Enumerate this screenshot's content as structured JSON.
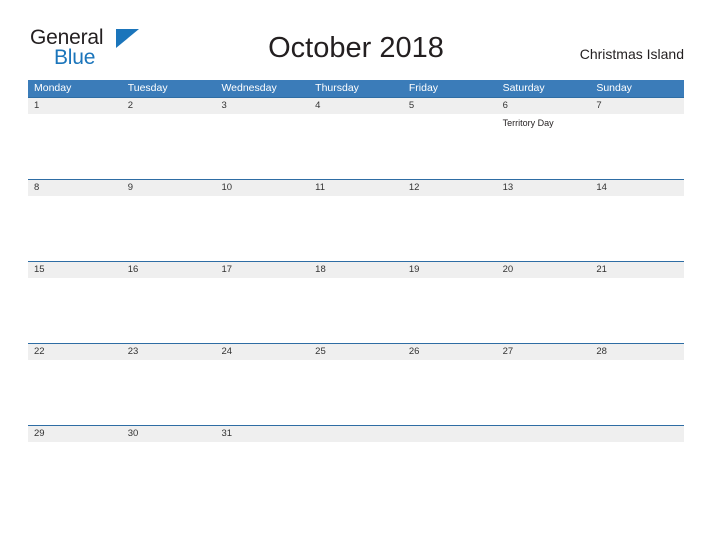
{
  "brand": {
    "name_top": "General",
    "name_bottom": "Blue",
    "triangle_icon": "triangle-icon",
    "accent_color": "#1b75bb"
  },
  "header": {
    "title": "October 2018",
    "location": "Christmas Island"
  },
  "calendar": {
    "header_color": "#3b7cb9",
    "band_color": "#efefef",
    "weekdays": [
      "Monday",
      "Tuesday",
      "Wednesday",
      "Thursday",
      "Friday",
      "Saturday",
      "Sunday"
    ],
    "weeks": [
      {
        "days": [
          {
            "num": "1",
            "event": ""
          },
          {
            "num": "2",
            "event": ""
          },
          {
            "num": "3",
            "event": ""
          },
          {
            "num": "4",
            "event": ""
          },
          {
            "num": "5",
            "event": ""
          },
          {
            "num": "6",
            "event": "Territory Day"
          },
          {
            "num": "7",
            "event": ""
          }
        ]
      },
      {
        "days": [
          {
            "num": "8",
            "event": ""
          },
          {
            "num": "9",
            "event": ""
          },
          {
            "num": "10",
            "event": ""
          },
          {
            "num": "11",
            "event": ""
          },
          {
            "num": "12",
            "event": ""
          },
          {
            "num": "13",
            "event": ""
          },
          {
            "num": "14",
            "event": ""
          }
        ]
      },
      {
        "days": [
          {
            "num": "15",
            "event": ""
          },
          {
            "num": "16",
            "event": ""
          },
          {
            "num": "17",
            "event": ""
          },
          {
            "num": "18",
            "event": ""
          },
          {
            "num": "19",
            "event": ""
          },
          {
            "num": "20",
            "event": ""
          },
          {
            "num": "21",
            "event": ""
          }
        ]
      },
      {
        "days": [
          {
            "num": "22",
            "event": ""
          },
          {
            "num": "23",
            "event": ""
          },
          {
            "num": "24",
            "event": ""
          },
          {
            "num": "25",
            "event": ""
          },
          {
            "num": "26",
            "event": ""
          },
          {
            "num": "27",
            "event": ""
          },
          {
            "num": "28",
            "event": ""
          }
        ]
      },
      {
        "days": [
          {
            "num": "29",
            "event": ""
          },
          {
            "num": "30",
            "event": ""
          },
          {
            "num": "31",
            "event": ""
          },
          {
            "num": "",
            "event": ""
          },
          {
            "num": "",
            "event": ""
          },
          {
            "num": "",
            "event": ""
          },
          {
            "num": "",
            "event": ""
          }
        ]
      }
    ]
  }
}
